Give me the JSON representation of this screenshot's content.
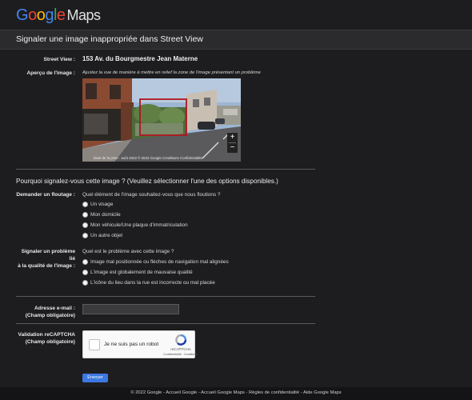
{
  "logo": {
    "letters": [
      "G",
      "o",
      "o",
      "g",
      "l",
      "e"
    ],
    "product": "Maps"
  },
  "title": "Signaler une image inappropriée dans Street View",
  "street_view": {
    "label": "Street View :",
    "value": "153 Av. du Bourgmestre Jean Materne"
  },
  "preview": {
    "label": "Aperçu de l'image :",
    "instruction": "Ajustez la vue de manière à mettre en relief la zone de l'image présentant un problème",
    "attribution": "Date de la prise : août 2022    © 2022 Google    Conditions    Confidentialité",
    "zoom_in": "+",
    "zoom_out": "−"
  },
  "reason_question": "Pourquoi signalez-vous cette image ?  (Veuillez sélectionner l'une des options disponibles.)",
  "blur": {
    "label": "Demander un floutage :",
    "question": "Quel élément de l'image souhaitez-vous que nous floutions ?",
    "options": [
      "Un visage",
      "Mon domicile",
      "Mon véhicule/Une plaque d'immatriculation",
      "Un autre objet"
    ]
  },
  "quality": {
    "label_line1": "Signaler un problème lié",
    "label_line2": "à la qualité de l'image :",
    "question": "Quel est le problème avec cette image ?",
    "options": [
      "Image mal positionnée ou flèches de navigation mal alignées",
      "L'image est globalement de mauvaise qualité",
      "L'icône du lieu dans la rue est incorrecte ou mal placée"
    ]
  },
  "email": {
    "label_line1": "Adresse e-mail :",
    "label_line2": "(Champ obligatoire)",
    "value": ""
  },
  "recaptcha": {
    "label_line1": "Validation reCAPTCHA",
    "label_line2": "(Champ obligatoire)",
    "checkbox_text": "Je ne suis pas un robot",
    "brand": "reCAPTCHA",
    "links": "Confidentialité - Conditions"
  },
  "submit_label": "Envoyer",
  "footer": "© 2022 Google - Accueil Google - Accueil Google Maps - Règles de confidentialité - Aide Google Maps"
}
